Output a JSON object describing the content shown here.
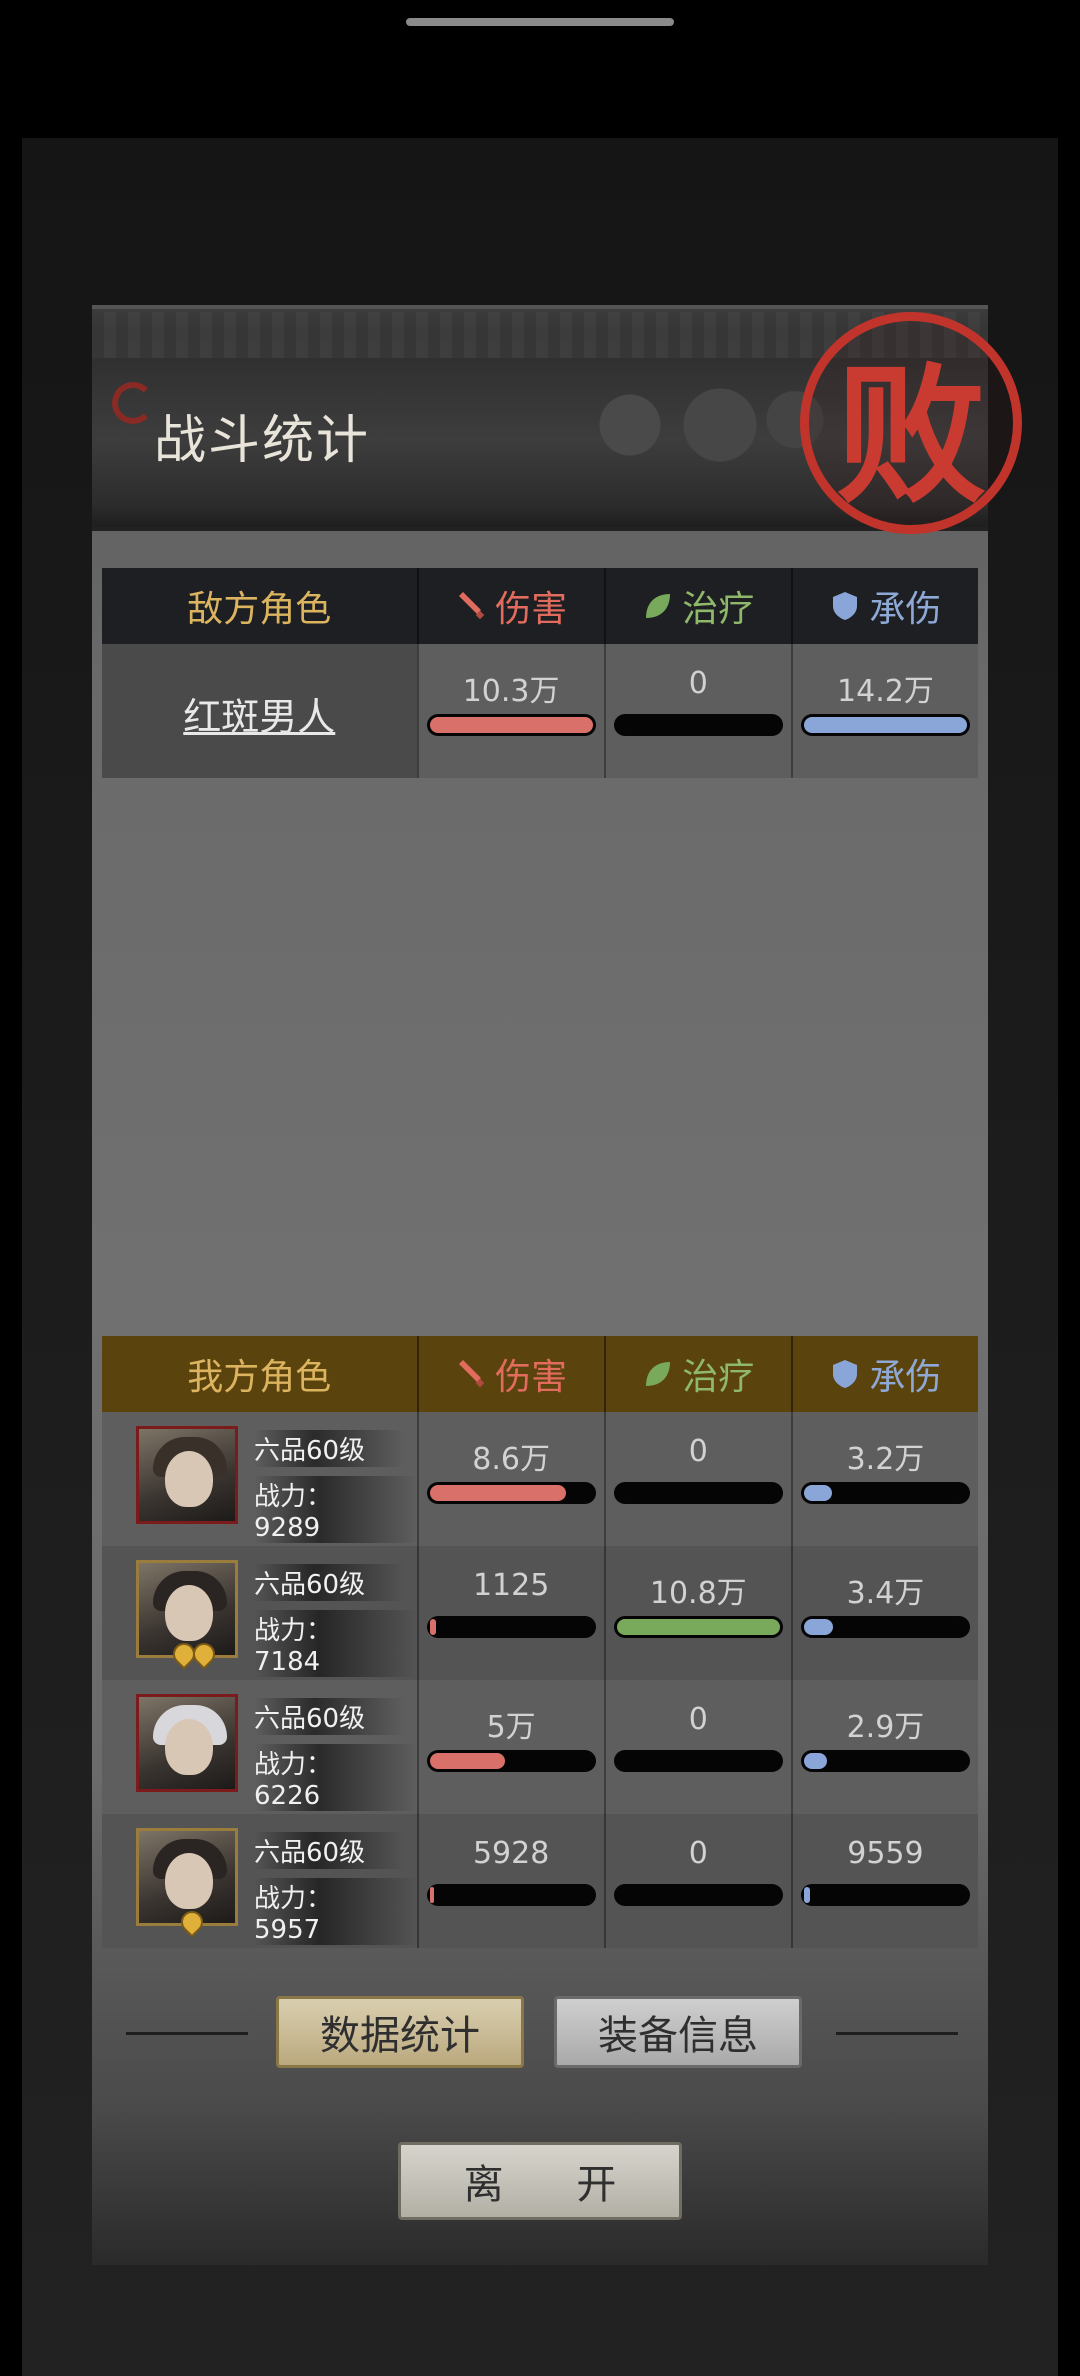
{
  "title": "战斗统计",
  "result_seal": "败",
  "headers": {
    "damage": "伤害",
    "heal": "治疗",
    "tank": "承伤"
  },
  "enemy": {
    "section_label": "敌方角色",
    "rows": [
      {
        "name": "红斑男人",
        "damage": "10.3万",
        "heal": "0",
        "tank": "14.2万",
        "damage_pct": 100,
        "heal_pct": 0,
        "tank_pct": 100
      }
    ]
  },
  "ally": {
    "section_label": "我方角色",
    "rows": [
      {
        "rank": "六品60级",
        "power_label": "战力：",
        "power": "9289",
        "damage": "8.6万",
        "heal": "0",
        "tank": "3.2万",
        "damage_pct": 84,
        "heal_pct": 0,
        "tank_pct": 20
      },
      {
        "rank": "六品60级",
        "power_label": "战力：",
        "power": "7184",
        "damage": "1125",
        "heal": "10.8万",
        "tank": "3.4万",
        "damage_pct": 1,
        "heal_pct": 100,
        "tank_pct": 21
      },
      {
        "rank": "六品60级",
        "power_label": "战力：",
        "power": "6226",
        "damage": "5万",
        "heal": "0",
        "tank": "2.9万",
        "damage_pct": 48,
        "heal_pct": 0,
        "tank_pct": 17
      },
      {
        "rank": "六品60级",
        "power_label": "战力：",
        "power": "5957",
        "damage": "5928",
        "heal": "0",
        "tank": "9559",
        "damage_pct": 6,
        "heal_pct": 0,
        "tank_pct": 1
      }
    ]
  },
  "buttons": {
    "stats": "数据统计",
    "equipment": "装备信息",
    "leave": "离 开"
  },
  "colors": {
    "damage": "#d9706a",
    "heal": "#79a95a",
    "tank": "#8aa6d8",
    "seal": "#c1342b"
  }
}
